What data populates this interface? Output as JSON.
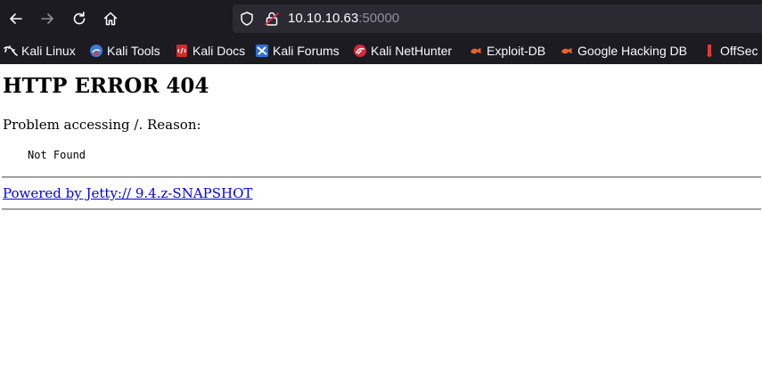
{
  "browser": {
    "url": {
      "host": "10.10.10.63",
      "port": ":50000"
    },
    "nav": {
      "back_icon": "arrow-left-icon",
      "forward_icon": "arrow-right-icon",
      "reload_icon": "reload-icon",
      "home_icon": "home-icon"
    },
    "bookmarks": [
      {
        "label": "Kali Linux",
        "icon": "kali-dragon-icon"
      },
      {
        "label": "Kali Tools",
        "icon": "kali-tools-icon"
      },
      {
        "label": "Kali Docs",
        "icon": "kali-docs-icon"
      },
      {
        "label": "Kali Forums",
        "icon": "kali-forums-icon"
      },
      {
        "label": "Kali NetHunter",
        "icon": "kali-nethunter-icon"
      },
      {
        "label": "Exploit-DB",
        "icon": "exploit-db-icon"
      },
      {
        "label": "Google Hacking DB",
        "icon": "ghdb-icon"
      },
      {
        "label": "OffSec",
        "icon": "offsec-icon"
      }
    ]
  },
  "page": {
    "title": "HTTP ERROR 404",
    "problem": "Problem accessing /. Reason:",
    "reason": "Not Found",
    "powered_by": "Powered by Jetty:// 9.4.z-SNAPSHOT"
  },
  "colors": {
    "chrome_bg": "#1c1b22",
    "urlbar_bg": "#2b2a33",
    "link": "#0000ee"
  }
}
